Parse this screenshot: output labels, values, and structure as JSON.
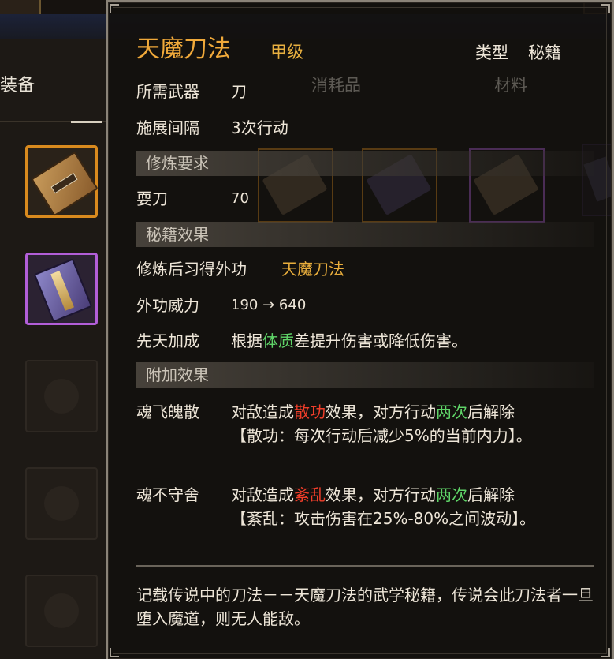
{
  "background": {
    "tab_label": "装备",
    "faded_tabs": [
      "消耗品",
      "材料"
    ]
  },
  "tooltip": {
    "title": "天魔刀法",
    "grade": "甲级",
    "type_label": "类型",
    "type_value": "秘籍",
    "info_rows": [
      {
        "label": "所需武器",
        "value": "刀"
      },
      {
        "label": "施展间隔",
        "value": "3次行动"
      }
    ],
    "section_requirements": "修炼要求",
    "requirement": {
      "label": "耍刀",
      "value": "70"
    },
    "section_effects": "秘籍效果",
    "learn": {
      "label": "修炼后习得外功",
      "value": "天魔刀法"
    },
    "power": {
      "label": "外功威力",
      "from": "190",
      "arrow": "→",
      "to": "640"
    },
    "innate": {
      "label": "先天加成",
      "pre": "根据",
      "highlight": "体质",
      "post": "差提升伤害或降低伤害。"
    },
    "section_extra": "附加效果",
    "extra_effects": [
      {
        "name": "魂飞魄散",
        "p1": "对敌造成",
        "status": "散功",
        "p2": "效果，对方行动",
        "count": "两次",
        "p3": "后解除",
        "detail": "【散功：每次行动后减少5%的当前内力】。"
      },
      {
        "name": "魂不守舍",
        "p1": "对敌造成",
        "status": "紊乱",
        "p2": "效果，对方行动",
        "count": "两次",
        "p3": "后解除",
        "detail": "【紊乱：攻击伤害在25%-80%之间波动】。"
      }
    ],
    "description": "记载传说中的刀法－－天魔刀法的武学秘籍，传说会此刀法者一旦堕入魔道，则无人能敌。"
  },
  "colors": {
    "title": "#f0a93a",
    "highlight_gold": "#e9ae3c",
    "highlight_green": "#5fd468",
    "highlight_red": "#f03e2a",
    "rare_border": "#d98a1e",
    "epic_border": "#b25ed8"
  }
}
